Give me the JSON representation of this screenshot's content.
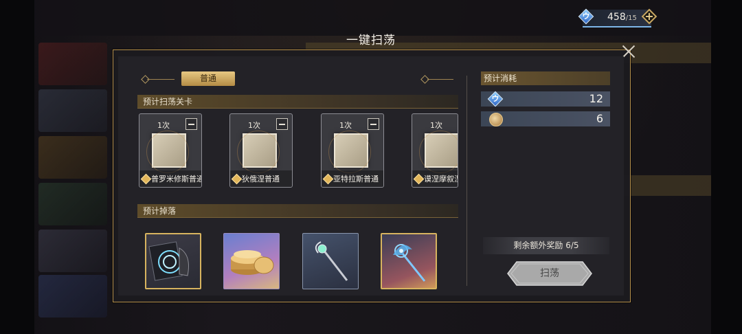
{
  "top_bar": {
    "currency_value": "458",
    "currency_cap": "/15"
  },
  "dialog": {
    "title": "一键扫荡",
    "tab_label": "普通",
    "stages_header": "预计扫荡关卡",
    "drops_header": "预计掉落",
    "stages": [
      {
        "count": "1次",
        "name": "普罗米修斯普通"
      },
      {
        "count": "1次",
        "name": "狄俄涅普通"
      },
      {
        "count": "1次",
        "name": "亚特拉斯普通"
      },
      {
        "count": "1次",
        "name": "谟涅摩叙涅"
      }
    ],
    "drops": [
      {
        "icon": "crest-fragment-icon",
        "rarity": "gold"
      },
      {
        "icon": "gold-coins-icon",
        "rarity": "purple"
      },
      {
        "icon": "silver-staff-icon",
        "rarity": "blue"
      },
      {
        "icon": "crystal-staff-icon",
        "rarity": "orange"
      }
    ],
    "cost_header": "预计消耗",
    "costs": [
      {
        "icon": "stamina-diamond-icon",
        "value": "12"
      },
      {
        "icon": "ticket-coin-icon",
        "value": "6"
      }
    ],
    "extra_reward": "剩余额外奖励  6/5",
    "sweep_button": "扫荡"
  },
  "colors": {
    "accent_gold": "#c9a862",
    "panel_bg": "#232227",
    "border_gold": "#b7914d"
  }
}
